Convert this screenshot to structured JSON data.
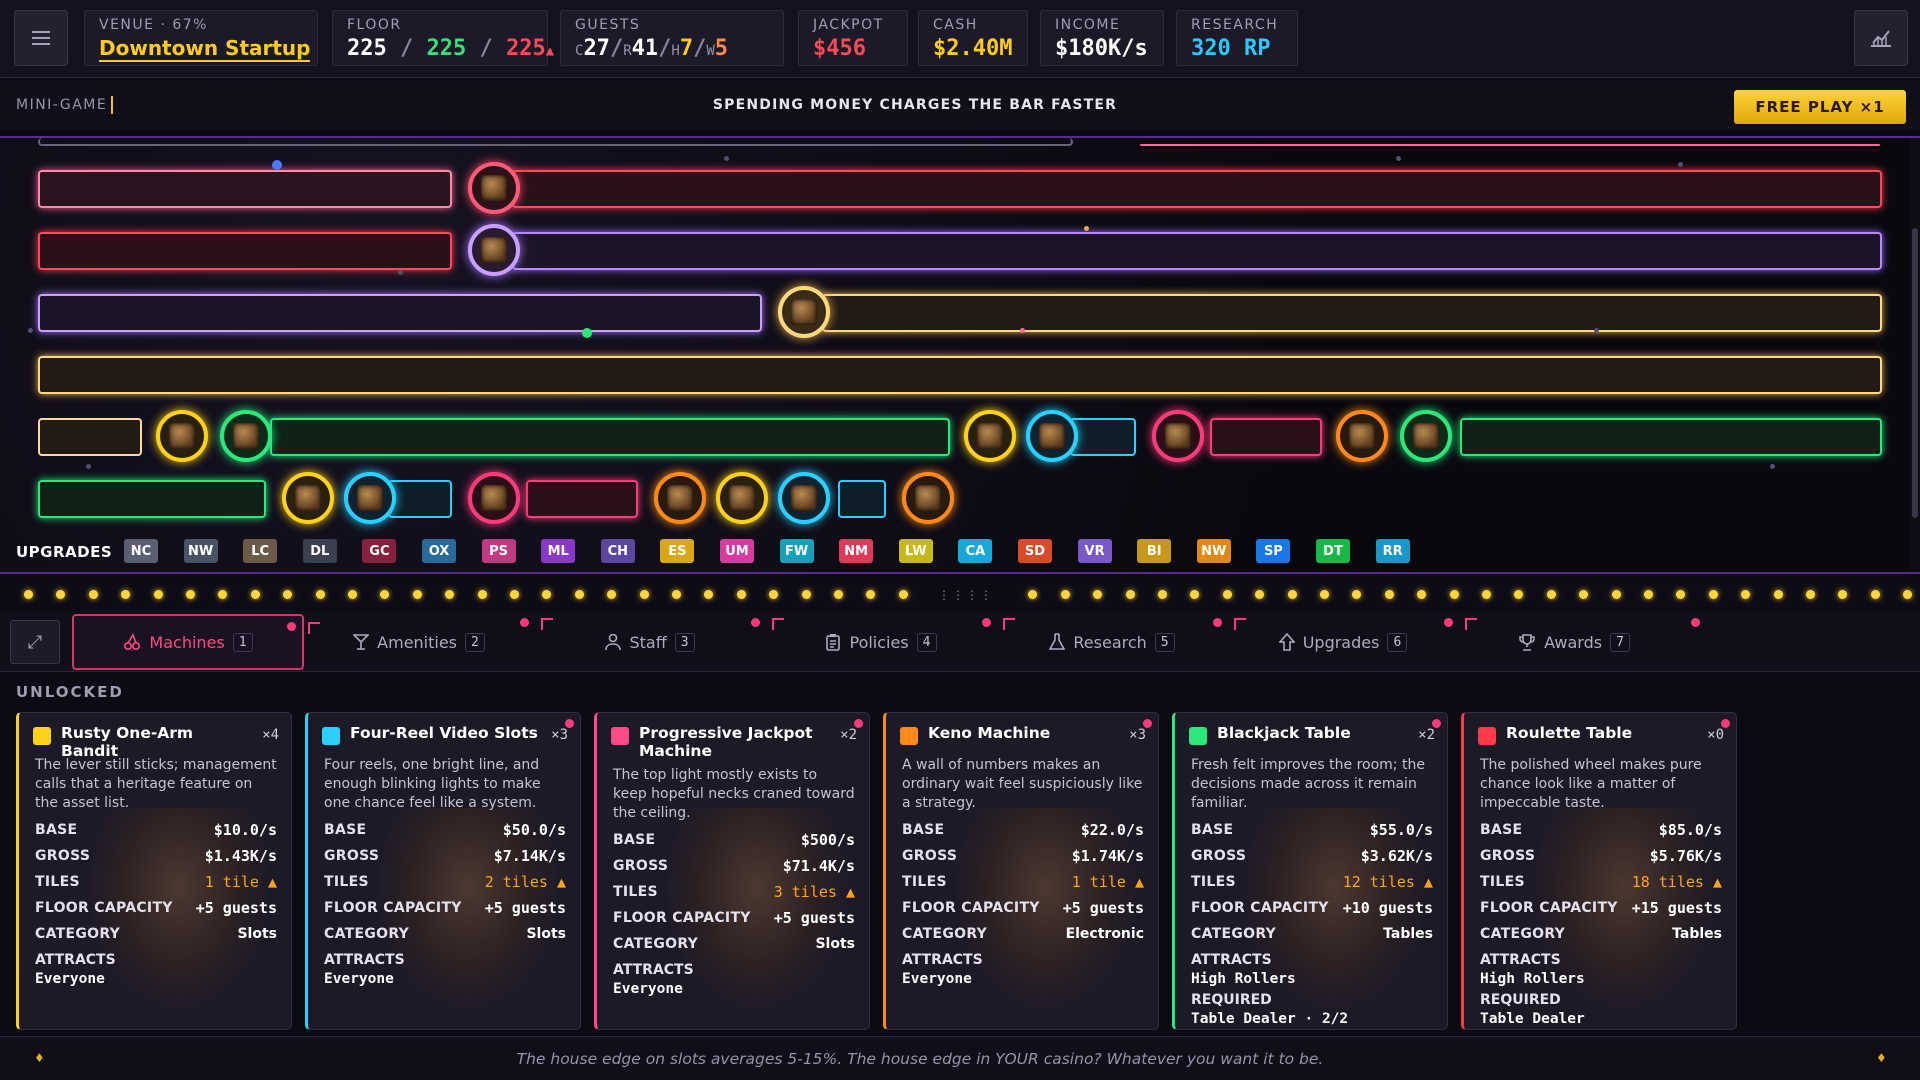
{
  "topbar": {
    "venue": {
      "label": "VENUE · 67%",
      "value": "Downtown Startup",
      "color": "#ffcc1a"
    },
    "floor": {
      "label": "FLOOR",
      "used": "225",
      "sep1": "/",
      "capacity": "225",
      "sep2": "/",
      "max": "225",
      "arrow": "▲"
    },
    "guests": {
      "label": "GUESTS",
      "c_label": "C",
      "c": "27",
      "r_label": "R",
      "r": "41",
      "h_label": "H",
      "h": "7",
      "w_label": "W",
      "w": "5"
    },
    "jackpot": {
      "label": "JACKPOT",
      "value": "$456",
      "color": "#ff4a5a"
    },
    "cash": {
      "label": "CASH",
      "value": "$2.40M",
      "color": "#ffcc1a"
    },
    "income": {
      "label": "INCOME",
      "value": "$180K/s",
      "color": "#ffffff"
    },
    "research": {
      "label": "RESEARCH",
      "value": "320 RP",
      "color": "#2ec8ff"
    },
    "menu_icon": "hamburger-icon",
    "stats_icon": "chart-icon"
  },
  "minigame": {
    "label": "MINI-GAME",
    "message": "SPENDING MONEY CHARGES THE BAR FASTER",
    "button": "FREE PLAY ×1"
  },
  "upgrades": {
    "label": "UPGRADES",
    "items": [
      {
        "code": "NC",
        "color": "#5a5f72"
      },
      {
        "code": "NW",
        "color": "#4a5266"
      },
      {
        "code": "LC",
        "color": "#6a5a48"
      },
      {
        "code": "DL",
        "color": "#3a4050"
      },
      {
        "code": "GC",
        "color": "#8a2040"
      },
      {
        "code": "OX",
        "color": "#2a6a98"
      },
      {
        "code": "PS",
        "color": "#c03a80"
      },
      {
        "code": "ML",
        "color": "#8a38c8"
      },
      {
        "code": "CH",
        "color": "#5a48a0"
      },
      {
        "code": "ES",
        "color": "#d8a818"
      },
      {
        "code": "UM",
        "color": "#d83aa0"
      },
      {
        "code": "FW",
        "color": "#18a0b8"
      },
      {
        "code": "NM",
        "color": "#e03a5a"
      },
      {
        "code": "LW",
        "color": "#c8b818"
      },
      {
        "code": "CA",
        "color": "#18a8d8"
      },
      {
        "code": "SD",
        "color": "#d84a28"
      },
      {
        "code": "VR",
        "color": "#7a58c8"
      },
      {
        "code": "BI",
        "color": "#c89818"
      },
      {
        "code": "NW",
        "color": "#e08818"
      },
      {
        "code": "SP",
        "color": "#1878e8"
      },
      {
        "code": "DT",
        "color": "#18b848"
      },
      {
        "code": "RR",
        "color": "#1898c8"
      }
    ]
  },
  "tabs": [
    {
      "label": "Machines",
      "num": "1",
      "icon": "cherries-icon",
      "active": true
    },
    {
      "label": "Amenities",
      "num": "2",
      "icon": "cocktail-icon"
    },
    {
      "label": "Staff",
      "num": "3",
      "icon": "person-icon"
    },
    {
      "label": "Policies",
      "num": "4",
      "icon": "clipboard-icon"
    },
    {
      "label": "Research",
      "num": "5",
      "icon": "flask-icon"
    },
    {
      "label": "Upgrades",
      "num": "6",
      "icon": "arrow-up-icon"
    },
    {
      "label": "Awards",
      "num": "7",
      "icon": "trophy-icon"
    }
  ],
  "unlocked_label": "UNLOCKED",
  "cards": [
    {
      "name": "Rusty One-Arm Bandit",
      "count": "×4",
      "color": "#ffd21a",
      "desc": "The lever still sticks; management calls that a heritage feature on the asset list.",
      "base_k": "BASE",
      "base": "$10.0/s",
      "gross_k": "GROSS",
      "gross": "$1.43K/s",
      "tiles_k": "TILES",
      "tiles": "1 tile ▲",
      "cap_k": "FLOOR CAPACITY",
      "cap": "+5 guests",
      "cat_k": "CATEGORY",
      "cat": "Slots",
      "att_k": "ATTRACTS",
      "att": "Everyone"
    },
    {
      "name": "Four-Reel Video Slots",
      "count": "×3",
      "color": "#2ad0ff",
      "desc": "Four reels, one bright line, and enough blinking lights to make one chance feel like a system.",
      "base_k": "BASE",
      "base": "$50.0/s",
      "gross_k": "GROSS",
      "gross": "$7.14K/s",
      "tiles_k": "TILES",
      "tiles": "2 tiles ▲",
      "cap_k": "FLOOR CAPACITY",
      "cap": "+5 guests",
      "cat_k": "CATEGORY",
      "cat": "Slots",
      "att_k": "ATTRACTS",
      "att": "Everyone"
    },
    {
      "name": "Progressive Jackpot Machine",
      "count": "×2",
      "color": "#ff4a8a",
      "desc": "The top light mostly exists to keep hopeful necks craned toward the ceiling.",
      "base_k": "BASE",
      "base": "$500/s",
      "gross_k": "GROSS",
      "gross": "$71.4K/s",
      "tiles_k": "TILES",
      "tiles": "3 tiles ▲",
      "cap_k": "FLOOR CAPACITY",
      "cap": "+5 guests",
      "cat_k": "CATEGORY",
      "cat": "Slots",
      "att_k": "ATTRACTS",
      "att": "Everyone"
    },
    {
      "name": "Keno Machine",
      "count": "×3",
      "color": "#ff8a1a",
      "desc": "A wall of numbers makes an ordinary wait feel suspiciously like a strategy.",
      "base_k": "BASE",
      "base": "$22.0/s",
      "gross_k": "GROSS",
      "gross": "$1.74K/s",
      "tiles_k": "TILES",
      "tiles": "1 tile ▲",
      "cap_k": "FLOOR CAPACITY",
      "cap": "+5 guests",
      "cat_k": "CATEGORY",
      "cat": "Electronic",
      "att_k": "ATTRACTS",
      "att": "Everyone"
    },
    {
      "name": "Blackjack Table",
      "count": "×2",
      "color": "#2ae87a",
      "desc": "Fresh felt improves the room; the decisions made across it remain familiar.",
      "base_k": "BASE",
      "base": "$55.0/s",
      "gross_k": "GROSS",
      "gross": "$3.62K/s",
      "tiles_k": "TILES",
      "tiles": "12 tiles ▲",
      "cap_k": "FLOOR CAPACITY",
      "cap": "+10 guests",
      "cat_k": "CATEGORY",
      "cat": "Tables",
      "att_k": "ATTRACTS",
      "att": "High Rollers",
      "req_k": "REQUIRED",
      "req": "Table Dealer · 2/2"
    },
    {
      "name": "Roulette Table",
      "count": "×0",
      "color": "#ff3a4a",
      "desc": "The polished wheel makes pure chance look like a matter of impeccable taste.",
      "base_k": "BASE",
      "base": "$85.0/s",
      "gross_k": "GROSS",
      "gross": "$5.76K/s",
      "tiles_k": "TILES",
      "tiles": "18 tiles ▲",
      "cap_k": "FLOOR CAPACITY",
      "cap": "+15 guests",
      "cat_k": "CATEGORY",
      "cat": "Tables",
      "att_k": "ATTRACTS",
      "att": "High Rollers",
      "req_k": "REQUIRED",
      "req": "Table Dealer"
    }
  ],
  "footer": {
    "tip": "The house edge on slots averages 5-15%. The house edge in YOUR casino? Whatever you want it to be.",
    "left_icon": "diamond-icon",
    "right_icon": "diamond-icon"
  }
}
